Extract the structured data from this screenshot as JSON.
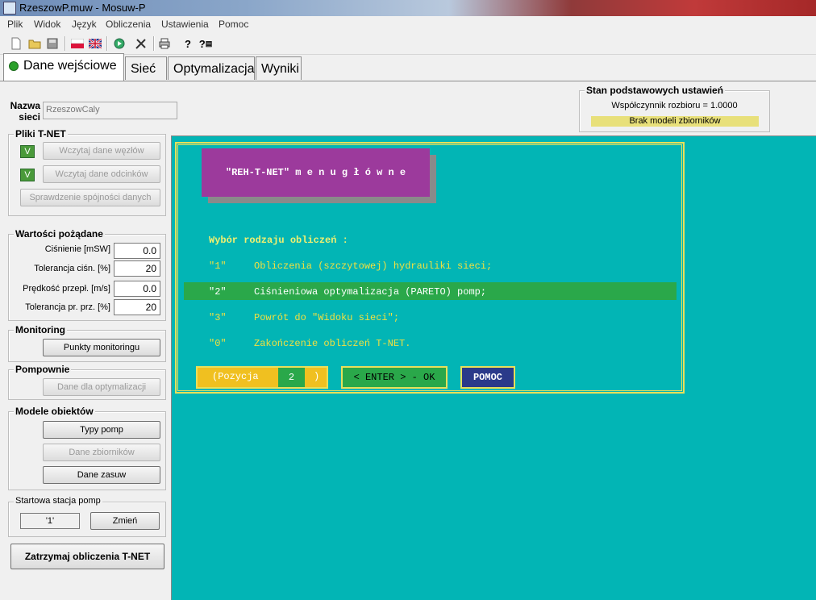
{
  "window": {
    "title": "RzeszowP.muw - Mosuw-P"
  },
  "menu": [
    "Plik",
    "Widok",
    "Język",
    "Obliczenia",
    "Ustawienia",
    "Pomoc"
  ],
  "toolbar_icons": [
    "new-file-icon",
    "open-folder-icon",
    "save-icon",
    "flag-pl-icon",
    "flag-uk-icon",
    "run-icon",
    "tools-icon",
    "print-icon",
    "help-icon",
    "context-help-icon"
  ],
  "tabs": [
    "Dane wejściowe",
    "Sieć",
    "Optymalizacja",
    "Wyniki"
  ],
  "network": {
    "label_line1": "Nazwa",
    "label_line2": "sieci",
    "value": "RzeszowCaly"
  },
  "status": {
    "title": "Stan podstawowych ustawień",
    "coefficient": "Współczynnik rozbioru = 1.0000",
    "warning": "Brak modeli zbiorników",
    "warning_color": "#e8e07a"
  },
  "files_group": {
    "title": "Pliki T-NET",
    "check1": "V",
    "btn1": "Wczytaj dane węzłów",
    "check2": "V",
    "btn2": "Wczytaj dane odcinków",
    "btn3": "Sprawdzenie spójności danych"
  },
  "values_group": {
    "title": "Wartości pożądane",
    "rows": [
      {
        "label": "Ciśnienie [mSW]",
        "value": "0.0"
      },
      {
        "label": "Tolerancja ciśn. [%]",
        "value": "20"
      },
      {
        "label": "Prędkość przepł. [m/s]",
        "value": "0.0"
      },
      {
        "label": "Tolerancja pr. prz. [%]",
        "value": "20"
      }
    ]
  },
  "monitoring": {
    "title": "Monitoring",
    "btn": "Punkty monitoringu"
  },
  "pumps": {
    "title": "Pompownie",
    "btn": "Dane dla optymalizacji"
  },
  "models": {
    "title": "Modele obiektów",
    "btn1": "Typy pomp",
    "btn2": "Dane zbiorników",
    "btn3": "Dane zasuw"
  },
  "station": {
    "title": "Startowa stacja pomp",
    "value": "'1'",
    "btn": "Zmień"
  },
  "stop_button": "Zatrzymaj obliczenia T-NET",
  "terminal": {
    "bg_color": "#02b5b5",
    "header": "\"REH-T-NET\" m e n u  g ł ó w n e",
    "prompt": "Wybór rodzaju obliczeń :",
    "options": [
      {
        "key": "\"1\"",
        "text": "Obliczenia (szczytowej) hydrauliki sieci;"
      },
      {
        "key": "\"2\"",
        "text": "Ciśnieniowa optymalizacja (PARETO) pomp;"
      },
      {
        "key": "\"3\"",
        "text": "Powrót do \"Widoku sieci\";"
      },
      {
        "key": "\"0\"",
        "text": "Zakończenie obliczeń T-NET."
      }
    ],
    "selected_index": 1,
    "position_label": "(Pozycja",
    "position_value": "2",
    "position_close": ")",
    "enter_label": "< ENTER > - OK",
    "help_label": "POMOC"
  }
}
